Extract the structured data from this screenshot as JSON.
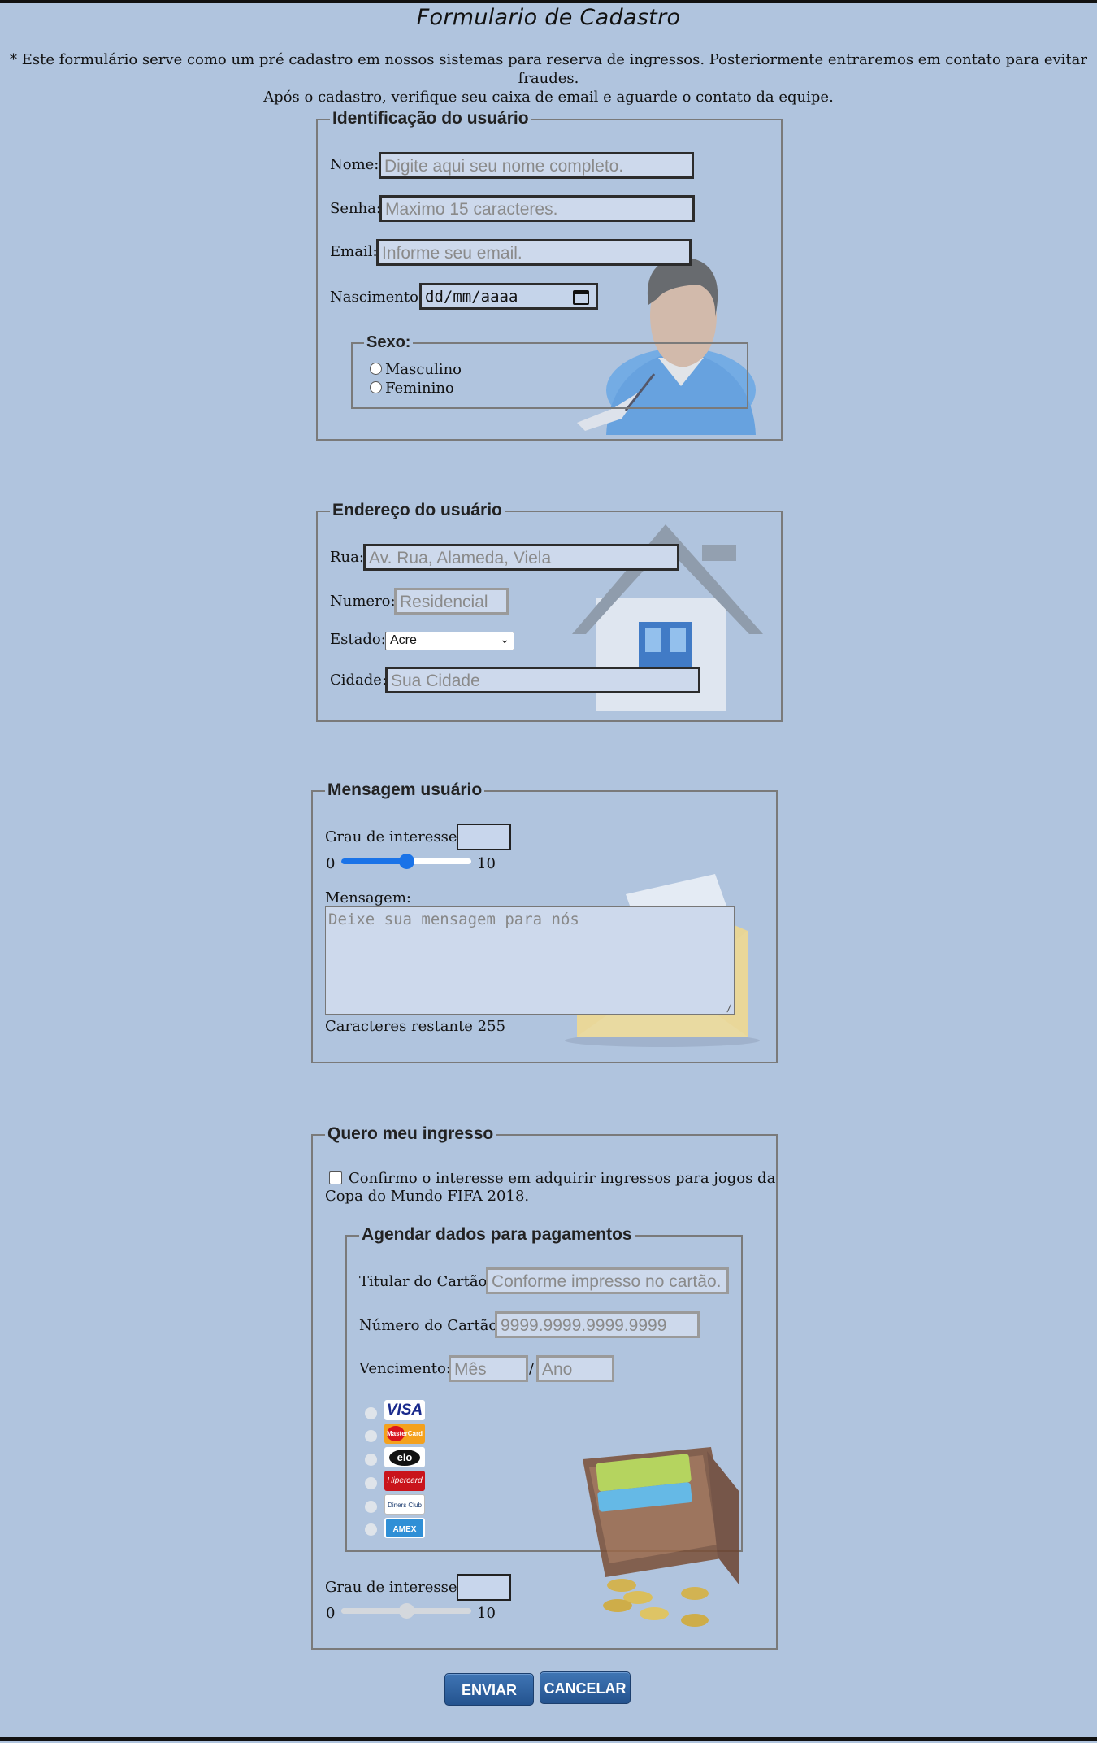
{
  "page": {
    "title": "Formulario de Cadastro",
    "intro_line1": "* Este formulário serve como um pré cadastro em nossos sistemas para reserva de ingressos. Posteriormente entraremos em contato para evitar fraudes.",
    "intro_line2": "Após o cadastro, verifique seu caixa de email e aguarde o contato da equipe."
  },
  "identificacao": {
    "legend": "Identificação do usuário",
    "nome_label": "Nome:",
    "nome_placeholder": "Digite aqui seu nome completo.",
    "senha_label": "Senha:",
    "senha_placeholder": "Maximo 15 caracteres.",
    "email_label": "Email:",
    "email_placeholder": "Informe seu email.",
    "nascimento_label": "Nascimento:",
    "nascimento_placeholder": "dd/mm/aaaa",
    "sexo_legend": "Sexo:",
    "sexo_options": [
      "Masculino",
      "Feminino"
    ]
  },
  "endereco": {
    "legend": "Endereço do usuário",
    "rua_label": "Rua:",
    "rua_placeholder": "Av. Rua, Alameda, Viela",
    "numero_label": "Numero:",
    "numero_placeholder": "Residencial",
    "estado_label": "Estado:",
    "estado_selected": "Acre",
    "cidade_label": "Cidade:",
    "cidade_placeholder": "Sua Cidade"
  },
  "mensagem": {
    "legend": "Mensagem usuário",
    "interesse_label": "Grau de interesse:",
    "slider_min": "0",
    "slider_max": "10",
    "slider_value": 5,
    "mensagem_label": "Mensagem:",
    "mensagem_placeholder": "Deixe sua mensagem para nós",
    "restante": "Caracteres restante 255"
  },
  "ingresso": {
    "legend": "Quero meu ingresso",
    "confirm_line1": "Confirmo o interesse em adquirir ingressos para jogos da",
    "confirm_line2": "Copa do Mundo FIFA 2018.",
    "pagamento_legend": "Agendar dados para pagamentos",
    "titular_label": "Titular do Cartão:",
    "titular_placeholder": "Conforme impresso no cartão.",
    "numero_label": "Número do Cartão:",
    "numero_placeholder": "9999.9999.9999.9999",
    "vencimento_label": "Vencimento:",
    "mes_placeholder": "Mês",
    "separator": "/",
    "ano_placeholder": "Ano",
    "cards": [
      "VISA",
      "MasterCard",
      "elo",
      "Hipercard",
      "Diners Club",
      "AMEX"
    ],
    "interesse_label": "Grau de interesse:",
    "slider_min": "0",
    "slider_max": "10",
    "slider_value": 5
  },
  "buttons": {
    "enviar": "ENVIAR",
    "cancelar": "CANCELAR"
  },
  "colors": {
    "background": "#b0c4de",
    "slider_active": "#1a73e8",
    "button": "#2e63a3"
  }
}
